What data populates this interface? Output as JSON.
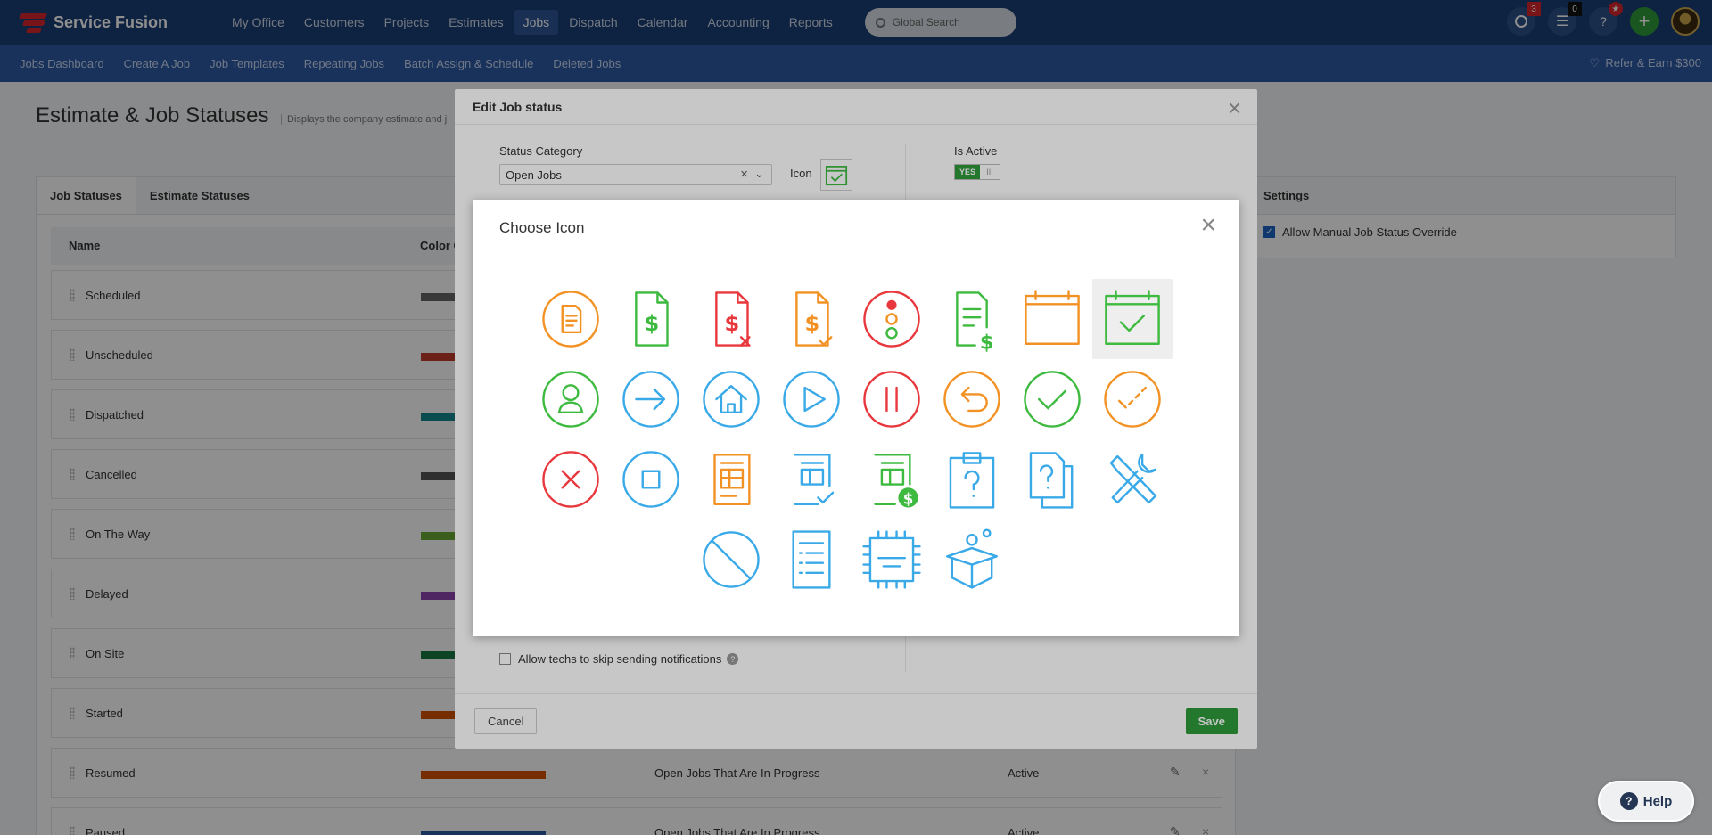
{
  "brand": {
    "name": "Service Fusion"
  },
  "nav": {
    "items": [
      {
        "label": "My Office"
      },
      {
        "label": "Customers"
      },
      {
        "label": "Projects"
      },
      {
        "label": "Estimates"
      },
      {
        "label": "Jobs"
      },
      {
        "label": "Dispatch"
      },
      {
        "label": "Calendar"
      },
      {
        "label": "Accounting"
      },
      {
        "label": "Reports"
      }
    ],
    "active": "Jobs",
    "search_placeholder": "Global Search",
    "chat_badge": "3",
    "tasks_badge": "0",
    "help_label": "?",
    "add_label": "+"
  },
  "subnav": {
    "items": [
      {
        "label": "Jobs Dashboard"
      },
      {
        "label": "Create A Job"
      },
      {
        "label": "Job Templates"
      },
      {
        "label": "Repeating Jobs"
      },
      {
        "label": "Batch Assign & Schedule"
      },
      {
        "label": "Deleted Jobs"
      }
    ],
    "refer": "Refer & Earn $300"
  },
  "page": {
    "title": "Estimate & Job Statuses",
    "description": "Displays the company estimate and j"
  },
  "tabs": {
    "job": "Job Statuses",
    "estimate": "Estimate Statuses"
  },
  "table": {
    "col_name": "Name",
    "col_color": "Color C",
    "rows": [
      {
        "name": "Scheduled",
        "color": "#666666",
        "category": "",
        "status": ""
      },
      {
        "name": "Unscheduled",
        "color": "#c0392b",
        "category": "",
        "status": ""
      },
      {
        "name": "Dispatched",
        "color": "#16888f",
        "category": "",
        "status": ""
      },
      {
        "name": "Cancelled",
        "color": "#555555",
        "category": "",
        "status": ""
      },
      {
        "name": "On The Way",
        "color": "#6aa832",
        "category": "",
        "status": ""
      },
      {
        "name": "Delayed",
        "color": "#8e44ad",
        "category": "",
        "status": ""
      },
      {
        "name": "On Site",
        "color": "#1a7a44",
        "category": "",
        "status": ""
      },
      {
        "name": "Started",
        "color": "#d35400",
        "category": "",
        "status": ""
      },
      {
        "name": "Resumed",
        "color": "#d35400",
        "category": "Open Jobs That Are In Progress",
        "status": "Active"
      },
      {
        "name": "Paused",
        "color": "#2b5aa6",
        "category": "Open Jobs That Are In Progress",
        "status": "Active"
      }
    ]
  },
  "settings": {
    "title": "Settings",
    "allow_manual": "Allow Manual Job Status Override"
  },
  "edit_modal": {
    "title": "Edit Job status",
    "status_category_label": "Status Category",
    "status_category_value": "Open Jobs",
    "icon_label": "Icon",
    "is_active_label": "Is Active",
    "toggle_yes": "YES",
    "toggle_off": "III",
    "skip_label": "Allow techs to skip sending notifications",
    "cancel": "Cancel",
    "save": "Save"
  },
  "choose_icon": {
    "title": "Choose Icon",
    "icons": [
      {
        "name": "document-icon",
        "color": "#f39224"
      },
      {
        "name": "invoice-dollar-icon",
        "color": "#3dba3f"
      },
      {
        "name": "invoice-cancel-icon",
        "color": "#e8383d"
      },
      {
        "name": "invoice-check-icon",
        "color": "#f39224"
      },
      {
        "name": "traffic-light-icon",
        "color": "#e8383d"
      },
      {
        "name": "list-dollar-icon",
        "color": "#3dba3f"
      },
      {
        "name": "calendar-icon",
        "color": "#f39224"
      },
      {
        "name": "calendar-check-icon",
        "color": "#3dba3f"
      },
      {
        "name": "user-icon",
        "color": "#3dba3f"
      },
      {
        "name": "arrow-right-icon",
        "color": "#3aa9e8"
      },
      {
        "name": "home-icon",
        "color": "#3aa9e8"
      },
      {
        "name": "play-icon",
        "color": "#3aa9e8"
      },
      {
        "name": "pause-icon",
        "color": "#e8383d"
      },
      {
        "name": "undo-icon",
        "color": "#f39224"
      },
      {
        "name": "check-circle-icon",
        "color": "#3dba3f"
      },
      {
        "name": "check-dashed-icon",
        "color": "#f39224"
      },
      {
        "name": "cancel-circle-icon",
        "color": "#e8383d"
      },
      {
        "name": "stop-icon",
        "color": "#3aa9e8"
      },
      {
        "name": "form-icon",
        "color": "#f39224"
      },
      {
        "name": "form-check-icon",
        "color": "#3aa9e8"
      },
      {
        "name": "form-dollar-icon",
        "color": "#3dba3f"
      },
      {
        "name": "clipboard-question-icon",
        "color": "#3aa9e8"
      },
      {
        "name": "docs-question-icon",
        "color": "#3aa9e8"
      },
      {
        "name": "tools-icon",
        "color": "#3aa9e8"
      },
      {
        "name": "blocked-icon",
        "color": "#3aa9e8"
      },
      {
        "name": "list-document-icon",
        "color": "#3aa9e8"
      },
      {
        "name": "chip-icon",
        "color": "#3aa9e8"
      },
      {
        "name": "box-gear-icon",
        "color": "#3aa9e8"
      }
    ],
    "selected": "calendar-check-icon"
  },
  "help": {
    "label": "Help"
  }
}
